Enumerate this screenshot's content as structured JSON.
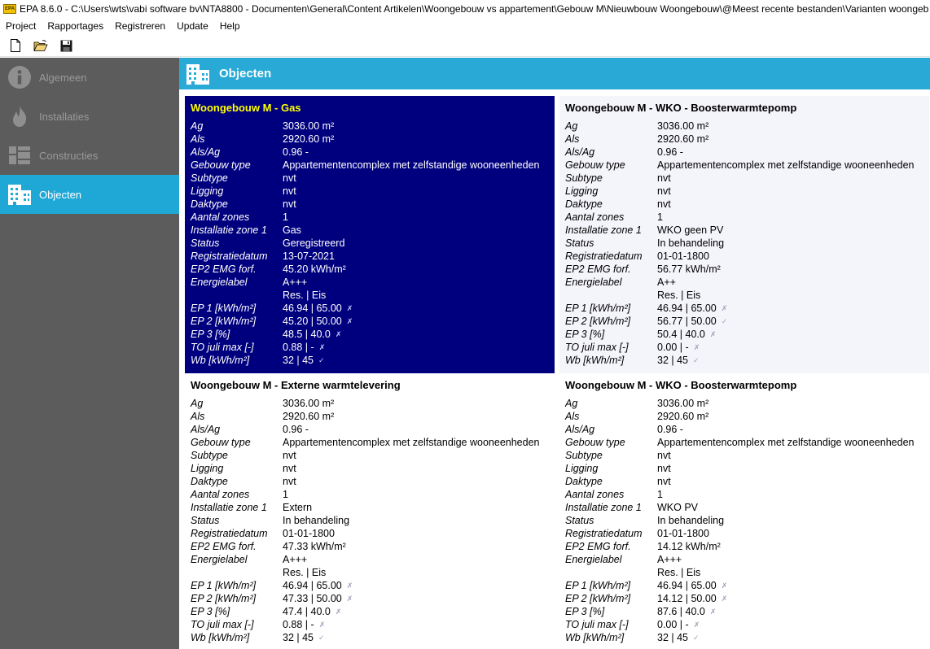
{
  "window": {
    "title": "EPA 8.6.0 - C:\\Users\\wts\\vabi software bv\\NTA8800 - Documenten\\General\\Content Artikelen\\Woongebouw vs appartement\\Gebouw M\\Nieuwbouw Woongebouw\\@Meest recente bestanden\\Varianten woongeb",
    "app_icon_text": "EPA"
  },
  "menu": [
    "Project",
    "Rapportages",
    "Registreren",
    "Update",
    "Help"
  ],
  "toolbar": {
    "icons": [
      "new-file-icon",
      "open-folder-icon",
      "save-disk-icon"
    ]
  },
  "sidebar": {
    "items": [
      {
        "label": "Algemeen",
        "icon": "info-icon",
        "active": false
      },
      {
        "label": "Installaties",
        "icon": "flame-icon",
        "active": false
      },
      {
        "label": "Constructies",
        "icon": "layout-blocks-icon",
        "active": false
      },
      {
        "label": "Objecten",
        "icon": "building-icon",
        "active": true
      }
    ]
  },
  "header": {
    "title": "Objecten",
    "icon": "building-icon"
  },
  "colors": {
    "sidebar": "#5c5c5c",
    "accent": "#29aad6",
    "selected_card": "#00007f",
    "selected_title": "#ffff00"
  },
  "cards": [
    {
      "title": "Woongebouw M - Gas",
      "selected": true,
      "rows": [
        {
          "k": "Ag",
          "v": "3036.00 m²"
        },
        {
          "k": "Als",
          "v": "2920.60 m²"
        },
        {
          "k": "Als/Ag",
          "v": "0.96 -"
        },
        {
          "k": "Gebouw type",
          "v": "Appartementencomplex met zelfstandige wooneenheden"
        },
        {
          "k": "Subtype",
          "v": "nvt"
        },
        {
          "k": "Ligging",
          "v": "nvt"
        },
        {
          "k": "Daktype",
          "v": "nvt"
        },
        {
          "k": "Aantal zones",
          "v": "1"
        },
        {
          "k": "Installatie zone 1",
          "v": "Gas"
        },
        {
          "k": "Status",
          "v": "Geregistreerd"
        },
        {
          "k": "Registratiedatum",
          "v": "13-07-2021"
        },
        {
          "k": "EP2 EMG forf.",
          "v": "45.20 kWh/m²"
        },
        {
          "k": "Energielabel",
          "v": "A+++"
        },
        {
          "k": "",
          "v": "Res. | Eis"
        },
        {
          "k": "EP 1 [kWh/m²]",
          "v": "46.94 | 65.00",
          "m": "✗"
        },
        {
          "k": "EP 2 [kWh/m²]",
          "v": "45.20 | 50.00",
          "m": "✗"
        },
        {
          "k": "EP 3 [%]",
          "v": "48.5 | 40.0",
          "m": "✗"
        },
        {
          "k": "TO juli max [-]",
          "v": "0.88 |  -",
          "m": "✗"
        },
        {
          "k": "Wb [kWh/m²]",
          "v": "32 | 45",
          "m": "✓"
        }
      ]
    },
    {
      "title": "Woongebouw M - WKO - Boosterwarmtepomp",
      "selected": false,
      "rows": [
        {
          "k": "Ag",
          "v": "3036.00 m²"
        },
        {
          "k": "Als",
          "v": "2920.60 m²"
        },
        {
          "k": "Als/Ag",
          "v": "0.96 -"
        },
        {
          "k": "Gebouw type",
          "v": "Appartementencomplex met zelfstandige wooneenheden"
        },
        {
          "k": "Subtype",
          "v": "nvt"
        },
        {
          "k": "Ligging",
          "v": "nvt"
        },
        {
          "k": "Daktype",
          "v": "nvt"
        },
        {
          "k": "Aantal zones",
          "v": "1"
        },
        {
          "k": "Installatie zone 1",
          "v": "WKO geen PV"
        },
        {
          "k": "Status",
          "v": "In behandeling"
        },
        {
          "k": "Registratiedatum",
          "v": "01-01-1800"
        },
        {
          "k": "EP2 EMG forf.",
          "v": "56.77 kWh/m²"
        },
        {
          "k": "Energielabel",
          "v": "A++"
        },
        {
          "k": "",
          "v": "Res. | Eis"
        },
        {
          "k": "EP 1 [kWh/m²]",
          "v": "46.94 | 65.00",
          "m": "✗"
        },
        {
          "k": "EP 2 [kWh/m²]",
          "v": "56.77 | 50.00",
          "m": "✓"
        },
        {
          "k": "EP 3 [%]",
          "v": "50.4 | 40.0",
          "m": "✗"
        },
        {
          "k": "TO juli max [-]",
          "v": "0.00 |  -",
          "m": "✗"
        },
        {
          "k": "Wb [kWh/m²]",
          "v": "32 | 45",
          "m": "✓"
        }
      ]
    },
    {
      "title": "Woongebouw M - Externe warmtelevering",
      "selected": false,
      "rows": [
        {
          "k": "Ag",
          "v": "3036.00 m²"
        },
        {
          "k": "Als",
          "v": "2920.60 m²"
        },
        {
          "k": "Als/Ag",
          "v": "0.96 -"
        },
        {
          "k": "Gebouw type",
          "v": "Appartementencomplex met zelfstandige wooneenheden"
        },
        {
          "k": "Subtype",
          "v": "nvt"
        },
        {
          "k": "Ligging",
          "v": "nvt"
        },
        {
          "k": "Daktype",
          "v": "nvt"
        },
        {
          "k": "Aantal zones",
          "v": "1"
        },
        {
          "k": "Installatie zone 1",
          "v": "Extern"
        },
        {
          "k": "Status",
          "v": "In behandeling"
        },
        {
          "k": "Registratiedatum",
          "v": "01-01-1800"
        },
        {
          "k": "EP2 EMG forf.",
          "v": "47.33 kWh/m²"
        },
        {
          "k": "Energielabel",
          "v": "A+++"
        },
        {
          "k": "",
          "v": "Res. | Eis"
        },
        {
          "k": "EP 1 [kWh/m²]",
          "v": "46.94 | 65.00",
          "m": "✗"
        },
        {
          "k": "EP 2 [kWh/m²]",
          "v": "47.33 | 50.00",
          "m": "✗"
        },
        {
          "k": "EP 3 [%]",
          "v": "47.4 | 40.0",
          "m": "✗"
        },
        {
          "k": "TO juli max [-]",
          "v": "0.88 |  -",
          "m": "✗"
        },
        {
          "k": "Wb [kWh/m²]",
          "v": "32 | 45",
          "m": "✓"
        }
      ]
    },
    {
      "title": "Woongebouw M - WKO - Boosterwarmtepomp",
      "selected": false,
      "rows": [
        {
          "k": "Ag",
          "v": "3036.00 m²"
        },
        {
          "k": "Als",
          "v": "2920.60 m²"
        },
        {
          "k": "Als/Ag",
          "v": "0.96 -"
        },
        {
          "k": "Gebouw type",
          "v": "Appartementencomplex met zelfstandige wooneenheden"
        },
        {
          "k": "Subtype",
          "v": "nvt"
        },
        {
          "k": "Ligging",
          "v": "nvt"
        },
        {
          "k": "Daktype",
          "v": "nvt"
        },
        {
          "k": "Aantal zones",
          "v": "1"
        },
        {
          "k": "Installatie zone 1",
          "v": "WKO PV"
        },
        {
          "k": "Status",
          "v": "In behandeling"
        },
        {
          "k": "Registratiedatum",
          "v": "01-01-1800"
        },
        {
          "k": "EP2 EMG forf.",
          "v": "14.12 kWh/m²"
        },
        {
          "k": "Energielabel",
          "v": "A+++"
        },
        {
          "k": "",
          "v": "Res. | Eis"
        },
        {
          "k": "EP 1 [kWh/m²]",
          "v": "46.94 | 65.00",
          "m": "✗"
        },
        {
          "k": "EP 2 [kWh/m²]",
          "v": "14.12 | 50.00",
          "m": "✗"
        },
        {
          "k": "EP 3 [%]",
          "v": "87.6 | 40.0",
          "m": "✗"
        },
        {
          "k": "TO juli max [-]",
          "v": "0.00 |  -",
          "m": "✗"
        },
        {
          "k": "Wb [kWh/m²]",
          "v": "32 | 45",
          "m": "✓"
        }
      ]
    }
  ]
}
